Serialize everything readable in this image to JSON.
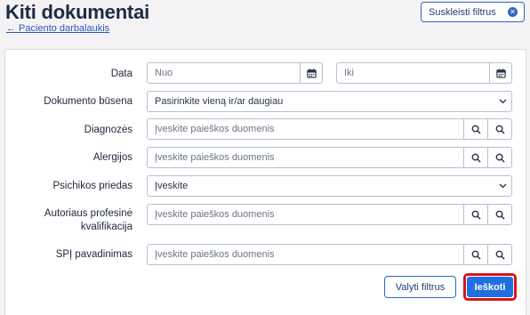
{
  "header": {
    "title": "Kiti dokumentai",
    "back_link": "← Paciento darbalaukis",
    "collapse_label": "Suskleisti filtrus"
  },
  "form": {
    "date_label": "Data",
    "date_from_placeholder": "Nuo",
    "date_to_placeholder": "Iki",
    "status_label": "Dokumento būsena",
    "status_value": "Pasirinkite vieną ir/ar daugiau",
    "diagnoses_label": "Diagnozės",
    "diagnoses_placeholder": "Įveskite paieškos duomenis",
    "allergies_label": "Alergijos",
    "allergies_placeholder": "Įveskite paieškos duomenis",
    "psych_label": "Psichikos priedas",
    "psych_value": "Įveskite",
    "author_label_line1": "Autoriaus profesinė",
    "author_label_line2": "kvalifikacija",
    "author_placeholder": "Įveskite paieškos duomenis",
    "spi_label": "SPĮ pavadinimas",
    "spi_placeholder": "Įveskite paieškos duomenis"
  },
  "actions": {
    "clear_label": "Valyti filtrus",
    "search_label": "Ieškoti"
  },
  "icons": {
    "calendar": "calendar-icon",
    "search": "search-icon",
    "chevron": "chevron-down-icon",
    "close": "close-icon"
  },
  "colors": {
    "accent": "#1f6fe0",
    "highlight": "#d9141b"
  }
}
